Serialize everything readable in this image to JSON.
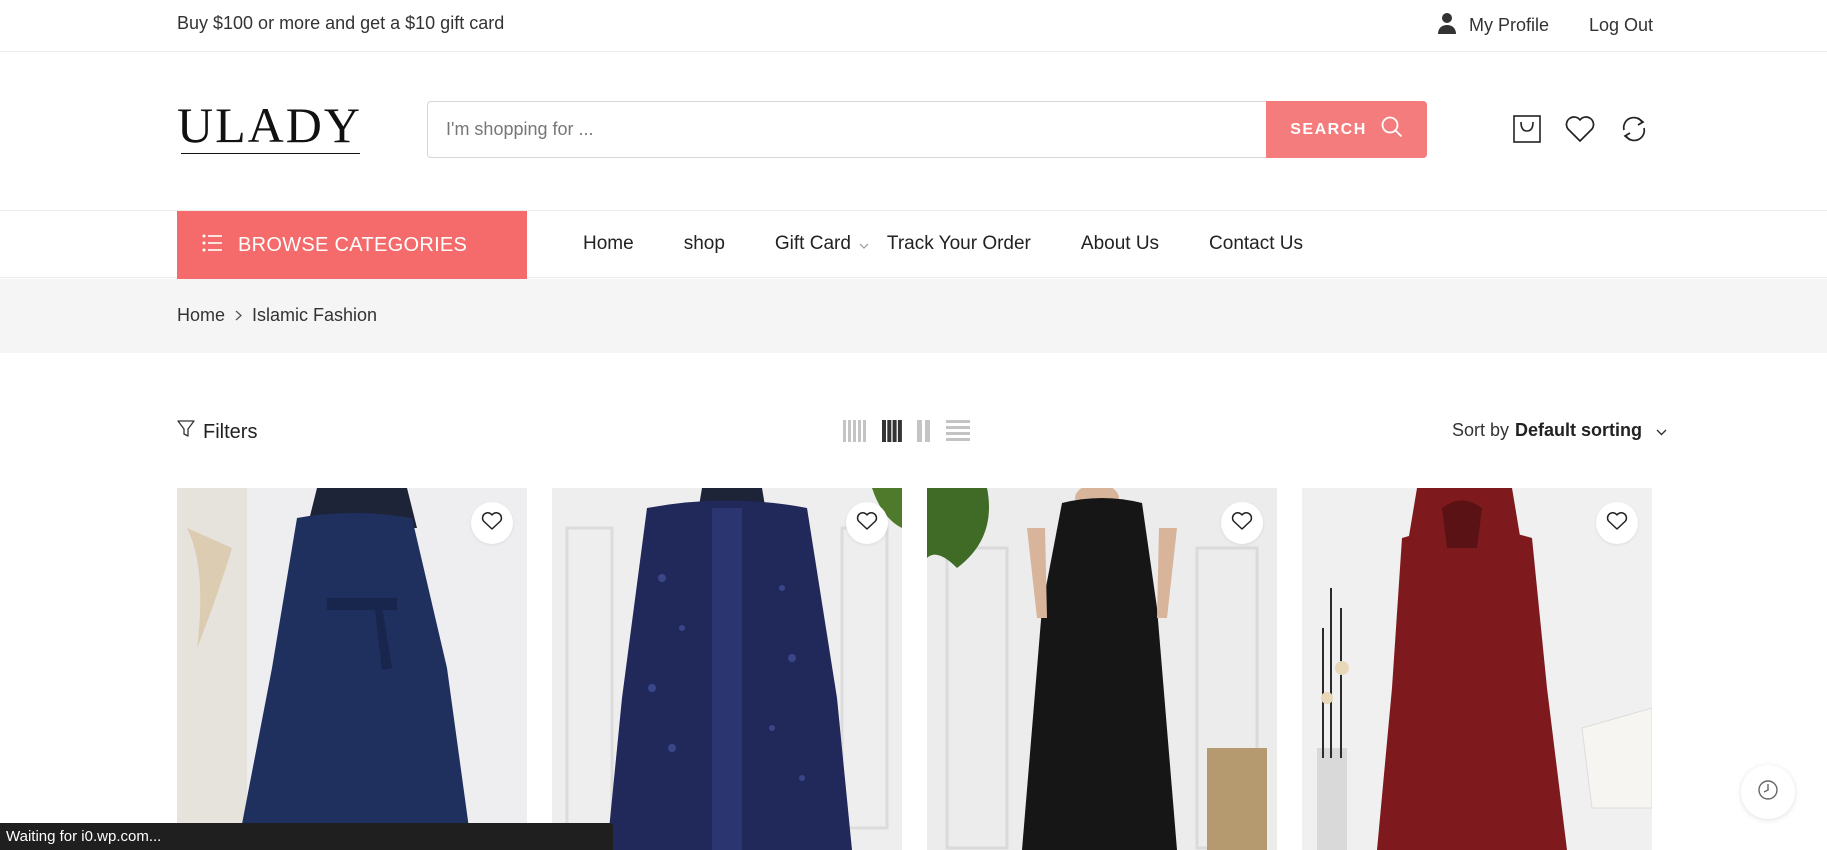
{
  "topbar": {
    "promo": "Buy $100 or more and get a $10 gift card",
    "profile_label": "My Profile",
    "profile_icon": "user-icon",
    "logout_label": "Log Out"
  },
  "header": {
    "logo_text": "ULADY",
    "search_placeholder": "I'm shopping for ...",
    "search_button": "SEARCH",
    "icons": [
      "cart-icon",
      "heart-icon",
      "compare-icon"
    ]
  },
  "nav": {
    "browse_label": "BROWSE CATEGORIES",
    "items": [
      {
        "label": "Home"
      },
      {
        "label": "shop"
      },
      {
        "label": "Gift Card",
        "has_dropdown": true
      },
      {
        "label": "Track Your Order"
      },
      {
        "label": "About Us"
      },
      {
        "label": "Contact Us"
      }
    ]
  },
  "breadcrumb": {
    "items": [
      "Home",
      "Islamic Fashion"
    ]
  },
  "toolbar": {
    "filters_label": "Filters",
    "view_modes": [
      "grid-5-icon",
      "grid-4-icon",
      "grid-2-icon",
      "list-icon"
    ],
    "active_view": "grid-4-icon",
    "sort_prefix": "Sort by",
    "sort_value": "Default sorting"
  },
  "products": [
    {
      "image": "navy-belted-abaya",
      "color": "#1f2f5e"
    },
    {
      "image": "navy-sequin-kimono-abaya",
      "color": "#20295a"
    },
    {
      "image": "black-sleeveless-maxi-dress",
      "color": "#161616"
    },
    {
      "image": "burgundy-prayer-dress",
      "color": "#7e1a1e"
    }
  ],
  "status_bar": "Waiting for i0.wp.com...",
  "colors": {
    "accent": "#f56b6b",
    "search_button": "#f47c7c",
    "breadcrumb_bg": "#f5f5f5"
  }
}
